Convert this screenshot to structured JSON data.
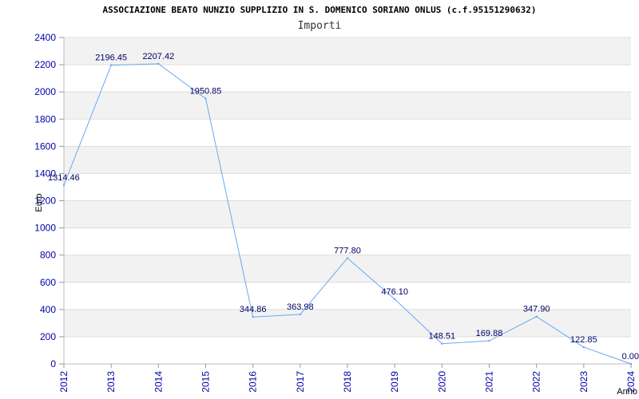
{
  "chart_data": {
    "type": "line",
    "title": "ASSOCIAZIONE BEATO NUNZIO SUPPLIZIO IN S. DOMENICO SORIANO ONLUS (c.f.95151290632)",
    "subtitle": "Importi",
    "xlabel": "Anno",
    "ylabel": "Euro",
    "ylim": [
      0,
      2400
    ],
    "yticks": [
      "0",
      "200",
      "400",
      "600",
      "800",
      "1000",
      "1200",
      "1400",
      "1600",
      "1800",
      "2000",
      "2200",
      "2400"
    ],
    "categories": [
      "2012",
      "2013",
      "2014",
      "2015",
      "2016",
      "2017",
      "2018",
      "2019",
      "2020",
      "2021",
      "2022",
      "2023",
      "2024"
    ],
    "series": [
      {
        "values": [
          1314.46,
          2196.45,
          2207.42,
          1950.85,
          344.86,
          363.98,
          777.8,
          476.1,
          148.51,
          169.88,
          347.9,
          122.85,
          0.0
        ],
        "labels": [
          "1314.46",
          "2196.45",
          "2207.42",
          "1950.85",
          "344.86",
          "363.98",
          "777.80",
          "476.10",
          "148.51",
          "169.88",
          "347.90",
          "122.85",
          "0.00"
        ]
      }
    ],
    "grid": true,
    "colors": {
      "line": "#66aaee",
      "band": "#f2f2f2",
      "tick_text": "#0000aa",
      "label_text": "#000066"
    }
  }
}
